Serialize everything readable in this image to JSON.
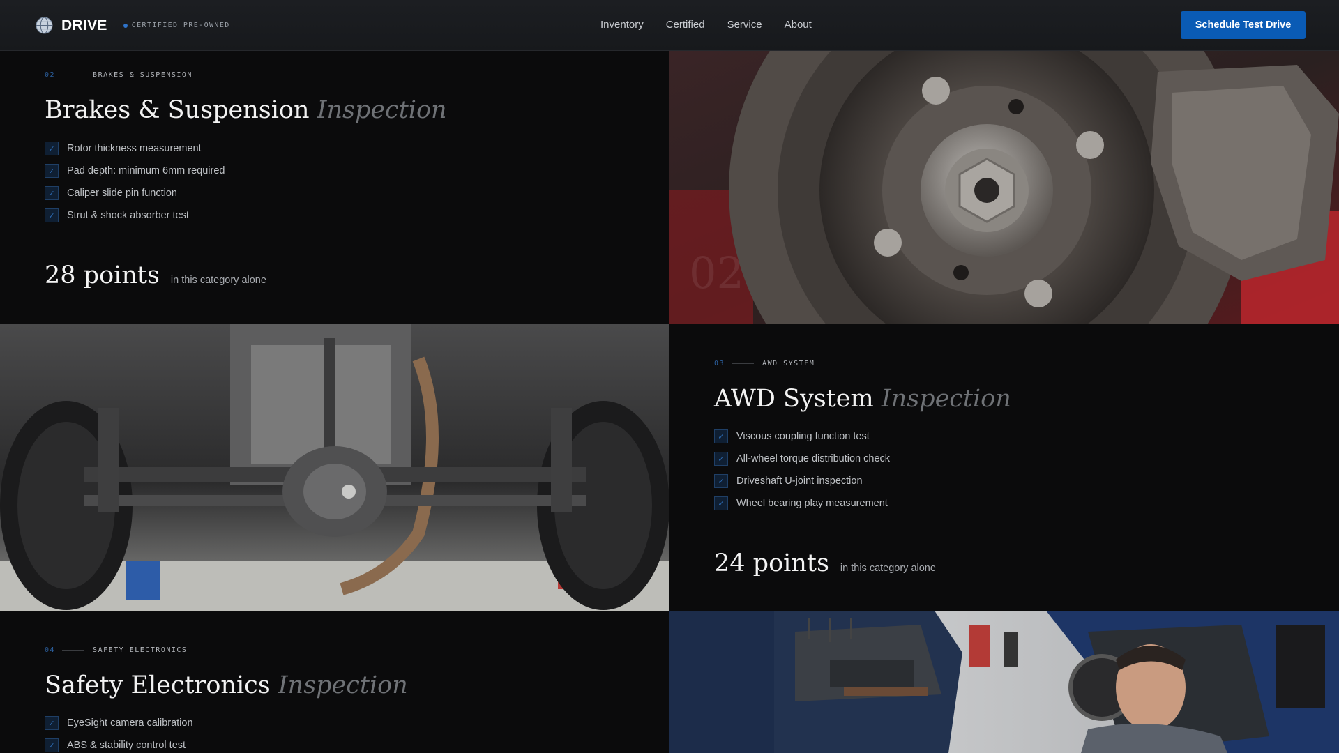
{
  "header": {
    "brand": "DRIVE",
    "tagline": "CERTIFIED PRE-OWNED",
    "nav": [
      "Inventory",
      "Certified",
      "Service",
      "About"
    ],
    "cta": "Schedule Test Drive"
  },
  "sections": [
    {
      "num": "02",
      "eyebrow": "BRAKES & SUSPENSION",
      "title": "Brakes & Suspension",
      "title_em": "Inspection",
      "items": [
        "Rotor thickness measurement",
        "Pad depth: minimum 6mm required",
        "Caliper slide pin function",
        "Strut & shock absorber test"
      ],
      "points": "28 points",
      "points_note": "in this category alone",
      "photo_label": "02"
    },
    {
      "num": "03",
      "eyebrow": "AWD SYSTEM",
      "title": "AWD System",
      "title_em": "Inspection",
      "items": [
        "Viscous coupling function test",
        "All-wheel torque distribution check",
        "Driveshaft U-joint inspection",
        "Wheel bearing play measurement"
      ],
      "points": "24 points",
      "points_note": "in this category alone"
    },
    {
      "num": "04",
      "eyebrow": "SAFETY ELECTRONICS",
      "title": "Safety Electronics",
      "title_em": "Inspection",
      "items": [
        "EyeSight camera calibration",
        "ABS & stability control test"
      ]
    }
  ],
  "colors": {
    "accent": "#0a5bb5",
    "background": "#0b0b0c",
    "checkbox_border": "#1f3f66"
  },
  "icons": [
    "globe-logo-icon",
    "check-icon"
  ]
}
